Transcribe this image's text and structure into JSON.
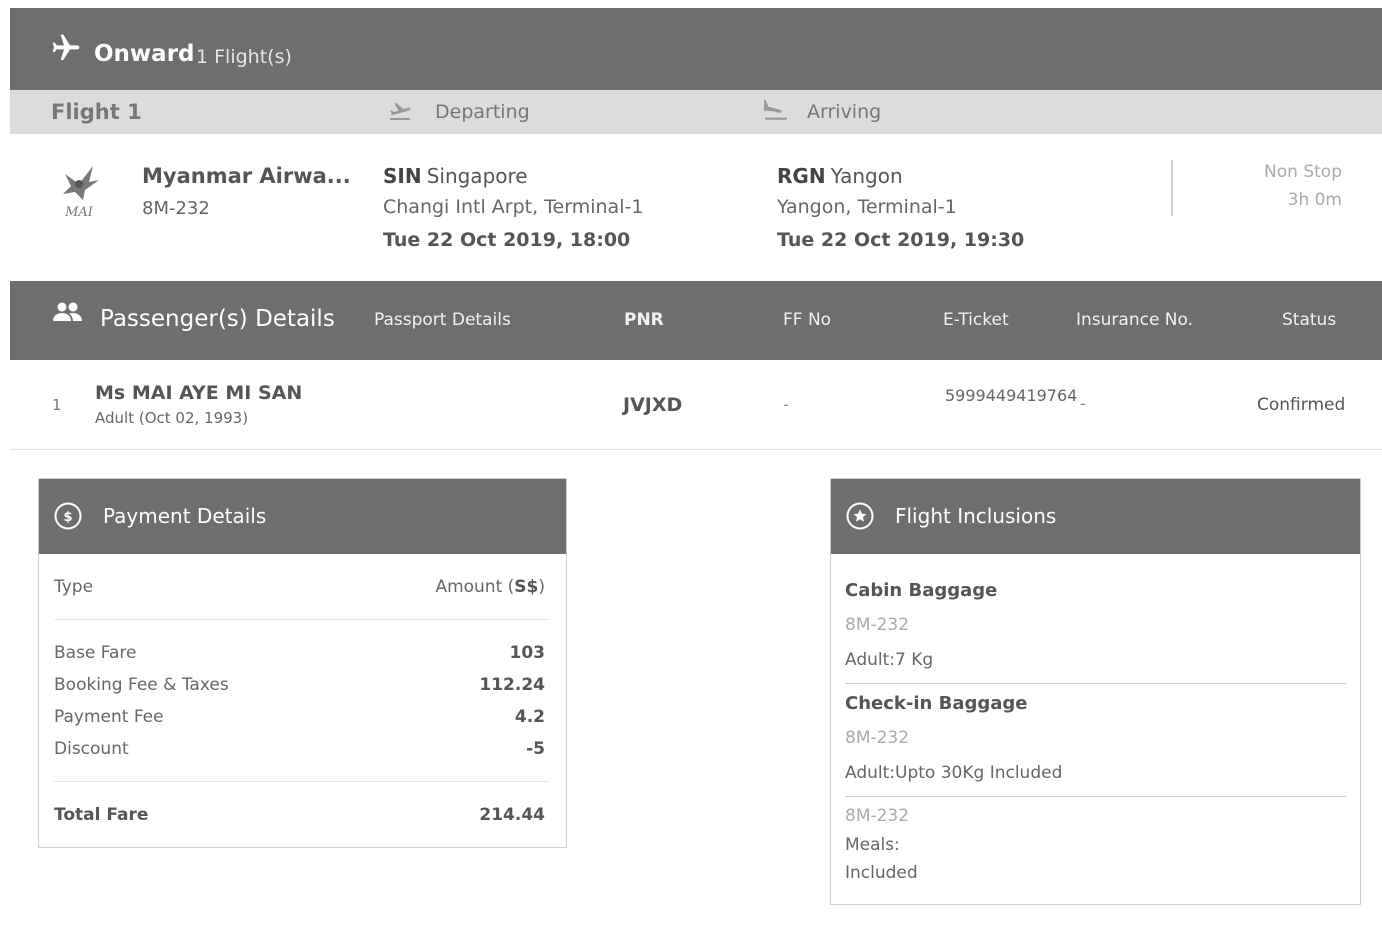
{
  "onward": {
    "title": "Onward",
    "count": "1 Flight(s)"
  },
  "flight_header": {
    "flight_label": "Flight 1",
    "departing_label": "Departing",
    "arriving_label": "Arriving"
  },
  "flight": {
    "airline_name": "Myanmar Airwa...",
    "flight_number": "8M-232",
    "logo_text": "MAI",
    "departure": {
      "code": "SIN",
      "city": "Singapore",
      "terminal": "Changi Intl Arpt, Terminal-1",
      "datetime": "Tue 22 Oct 2019, 18:00"
    },
    "arrival": {
      "code": "RGN",
      "city": "Yangon",
      "terminal": "Yangon, Terminal-1",
      "datetime": "Tue 22 Oct 2019, 19:30"
    },
    "stops": "Non Stop",
    "duration": "3h 0m"
  },
  "passengers_header": {
    "title": "Passenger(s) Details",
    "columns": [
      "Passport Details",
      "PNR",
      "FF No",
      "E-Ticket",
      "Insurance No.",
      "Status"
    ]
  },
  "passengers": [
    {
      "index": "1",
      "name": "Ms MAI AYE MI SAN",
      "detail": "Adult (Oct 02, 1993)",
      "pnr": "JVJXD",
      "ff_no": "-",
      "eticket": "5999449419764",
      "insurance": "-",
      "status": "Confirmed"
    }
  ],
  "payment": {
    "title": "Payment Details",
    "type_label": "Type",
    "amount_label": "Amount (",
    "currency": "S$",
    "amount_label_end": ")",
    "rows": [
      {
        "label": "Base Fare",
        "value": "103"
      },
      {
        "label": "Booking Fee & Taxes",
        "value": "112.24"
      },
      {
        "label": "Payment Fee",
        "value": "4.2"
      },
      {
        "label": "Discount",
        "value": "-5"
      }
    ],
    "total": {
      "label": "Total Fare",
      "value": "214.44"
    }
  },
  "inclusions": {
    "title": "Flight Inclusions",
    "cabin": {
      "title": "Cabin Baggage",
      "flight": "8M-232",
      "detail": "Adult:7 Kg"
    },
    "checkin": {
      "title": "Check-in Baggage",
      "flight": "8M-232",
      "detail": "Adult:Upto 30Kg Included"
    },
    "meals": {
      "flight": "8M-232",
      "label": "Meals:",
      "detail": "Included"
    }
  },
  "colors": {
    "header_bar": "#6e6e6e",
    "subheader_bar": "#dcdcdc"
  },
  "icons": {
    "onward": "airplane-icon",
    "departing": "takeoff-icon",
    "arriving": "landing-icon",
    "passengers": "people-icon",
    "payment": "dollar-circle-icon",
    "inclusions": "star-circle-icon"
  }
}
